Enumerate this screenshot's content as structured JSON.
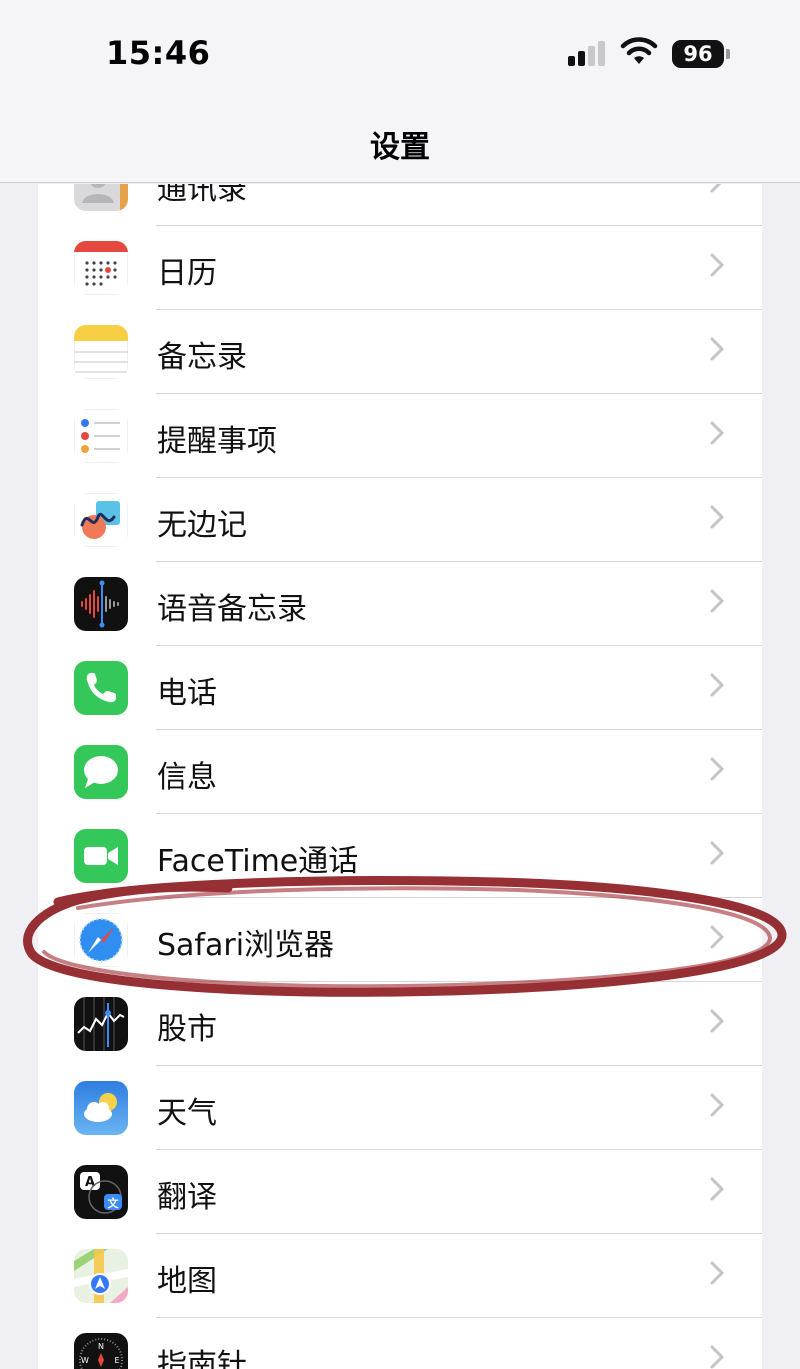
{
  "status_bar": {
    "time": "15:46",
    "battery": "96"
  },
  "nav": {
    "title": "设置"
  },
  "rows": [
    {
      "label": "通讯录",
      "icon": "contacts-icon"
    },
    {
      "label": "日历",
      "icon": "calendar-icon"
    },
    {
      "label": "备忘录",
      "icon": "notes-icon"
    },
    {
      "label": "提醒事项",
      "icon": "reminders-icon"
    },
    {
      "label": "无边记",
      "icon": "freeform-icon"
    },
    {
      "label": "语音备忘录",
      "icon": "voice-memos-icon"
    },
    {
      "label": "电话",
      "icon": "phone-icon"
    },
    {
      "label": "信息",
      "icon": "messages-icon"
    },
    {
      "label": "FaceTime通话",
      "icon": "facetime-icon"
    },
    {
      "label": "Safari浏览器",
      "icon": "safari-icon"
    },
    {
      "label": "股市",
      "icon": "stocks-icon"
    },
    {
      "label": "天气",
      "icon": "weather-icon"
    },
    {
      "label": "翻译",
      "icon": "translate-icon"
    },
    {
      "label": "地图",
      "icon": "maps-icon"
    },
    {
      "label": "指南针",
      "icon": "compass-icon"
    }
  ],
  "colors": {
    "highlight": "#8b1a1f",
    "phone_green": "#34c759",
    "chevron": "#c4c4c7"
  }
}
